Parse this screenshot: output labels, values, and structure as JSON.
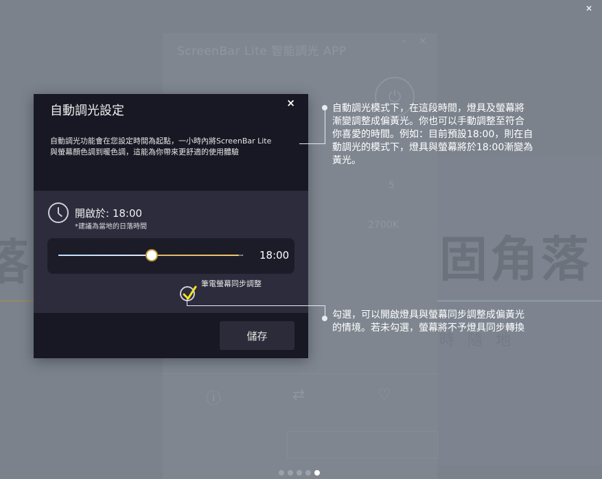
{
  "background": {
    "app_title": "ScreenBar Lite 智能調光 APP",
    "value_5": "5",
    "kelvin": "2700K",
    "big_text": "固角落",
    "big_text_left": "落",
    "small_text": "時 隨 地"
  },
  "outer_close": "×",
  "dialog": {
    "title": "自動調光設定",
    "close": "×",
    "description_line1": "自動調光功能會在您設定時間為起點，一小時內將ScreenBar Lite",
    "description_line2": "與螢幕顏色調到暖色調，這能為你帶來更舒適的使用體驗",
    "start_label": "開啟於: 18:00",
    "start_hint": "*建議為當地的日落時間",
    "slider_value": "18:00",
    "slider_position_fraction": 0.52,
    "sync_label": "筆電螢幕同步調整",
    "sync_checked": true,
    "save_label": "儲存"
  },
  "annotations": {
    "top_line1": "自動調光模式下，在這段時間，燈具及螢幕將",
    "top_line2": "漸變調整成偏黃光。你也可以手動調整至符合",
    "top_line3": "你喜愛的時間。例如：目前預設18:00，則在自",
    "top_line4": "動調光的模式下，燈具與螢幕將於18:00漸變為",
    "top_line5": "黃光。",
    "bottom_line1": "勾選，可以開啟燈具與螢幕同步調整成偏黃光",
    "bottom_line2": "的情境。若未勾選，螢幕將不予燈具同步轉換"
  },
  "pagination": {
    "total": 5,
    "active": 5
  },
  "colors": {
    "overlay": "#7b828c",
    "dialog_bg": "#2a2a3a",
    "dialog_header": "#181824",
    "accent_warm": "#f3c868",
    "accent_cool": "#bfe3ff",
    "check": "#f5e61e"
  }
}
